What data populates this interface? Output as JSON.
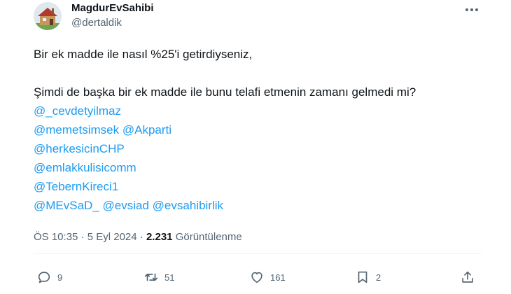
{
  "author": {
    "display_name": "MagdurEvSahibi",
    "handle": "@dertaldik",
    "avatar_icon": "house-avatar-icon"
  },
  "menu": {
    "more_icon": "more-dots-icon"
  },
  "tweet": {
    "line1": "Bir ek madde ile nasıl %25'i getirdiyseniz,",
    "line2": "Şimdi de başka bir ek madde ile bunu telafi etmenin zamanı gelmedi mi?",
    "mentions": {
      "m1": "@_cevdetyilmaz",
      "m2": "@memetsimsek",
      "m3": "@Akparti",
      "m4": "@herkesicinCHP",
      "m5": "@emlakkulisicomm",
      "m6": "@TebernKireci1",
      "m7": "@MEvSaD_",
      "m8": "@evsiad",
      "m9": "@evsahibirlik"
    }
  },
  "meta": {
    "time": "ÖS 10:35",
    "separator": "·",
    "date": "5 Eyl 2024",
    "views_count": "2.231",
    "views_label": "Görüntülenme"
  },
  "actions": {
    "reply_count": "9",
    "retweet_count": "51",
    "like_count": "161",
    "bookmark_count": "2"
  },
  "colors": {
    "link": "#1d9bf0",
    "secondary_text": "#536471",
    "primary_text": "#0f1419"
  }
}
